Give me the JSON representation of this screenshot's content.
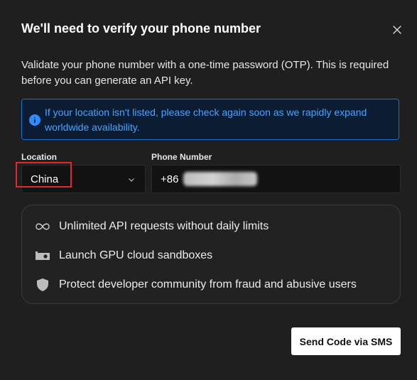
{
  "dialog": {
    "title": "We'll need to verify your phone number",
    "description": "Validate your phone number with a one-time password (OTP). This is required before you can generate an API key.",
    "info_message": "If your location isn't listed, please check again soon as we rapidly expand worldwide availability.",
    "location": {
      "label": "Location",
      "value": "China"
    },
    "phone": {
      "label": "Phone Number",
      "value": "+86"
    },
    "features": [
      {
        "icon": "infinity-icon",
        "text": "Unlimited API requests without daily limits"
      },
      {
        "icon": "gpu-card-icon",
        "text": "Launch GPU cloud sandboxes"
      },
      {
        "icon": "shield-icon",
        "text": "Protect developer community from fraud and abusive users"
      }
    ],
    "send_button": "Send Code via SMS"
  },
  "colors": {
    "background": "#1f1f1f",
    "info_border": "#1f6fcf",
    "info_text": "#4aa3ff",
    "highlight": "#e0282e",
    "button": "#ffffff"
  }
}
